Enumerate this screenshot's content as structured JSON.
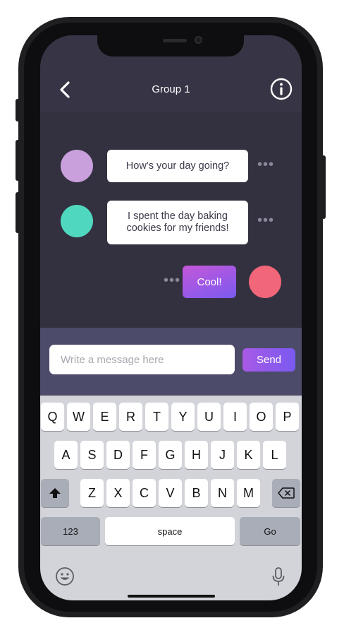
{
  "header": {
    "title": "Group 1"
  },
  "messages": [
    {
      "sender": "other",
      "avatar_color": "#c9a0dc",
      "text": "How’s your day going?"
    },
    {
      "sender": "other",
      "avatar_color": "#4fd8bf",
      "text": "I spent the day baking cookies for my friends!"
    },
    {
      "sender": "me",
      "avatar_color": "#f2667a",
      "text": "Cool!"
    }
  ],
  "composer": {
    "placeholder": "Write a message here",
    "send_label": "Send"
  },
  "keyboard": {
    "row1": [
      "Q",
      "W",
      "E",
      "R",
      "T",
      "Y",
      "U",
      "I",
      "O",
      "P"
    ],
    "row2": [
      "A",
      "S",
      "D",
      "F",
      "G",
      "H",
      "J",
      "K",
      "L"
    ],
    "row3": [
      "Z",
      "X",
      "C",
      "V",
      "B",
      "N",
      "M"
    ],
    "numbers_label": "123",
    "space_label": "space",
    "go_label": "Go"
  },
  "colors": {
    "accent_start": "#c457d9",
    "accent_end": "#7a5af0",
    "chat_bg": "#33313f"
  }
}
